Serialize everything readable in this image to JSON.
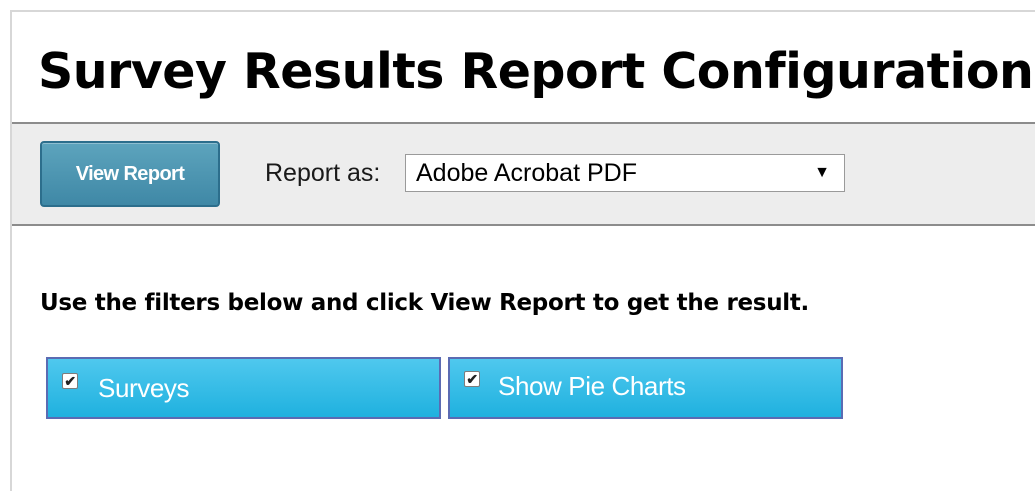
{
  "page": {
    "title": "Survey Results Report Configuration"
  },
  "toolbar": {
    "view_report_label": "View Report",
    "report_as_label": "Report as:",
    "report_format": {
      "selected": "Adobe Acrobat PDF"
    }
  },
  "main": {
    "instructions": "Use the filters below and click View Report to get the result.",
    "filters": [
      {
        "label": "Surveys",
        "checked": true
      },
      {
        "label": "Show Pie Charts",
        "checked": true
      }
    ]
  },
  "colors": {
    "button_bg": "#4b95b2",
    "filter_bg": "#2bb9e6",
    "toolbar_bg": "#ededed"
  }
}
